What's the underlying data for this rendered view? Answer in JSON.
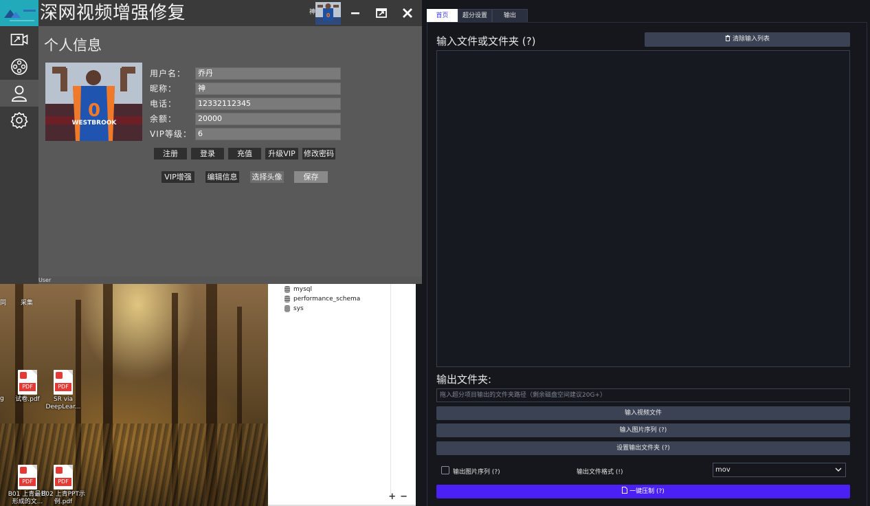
{
  "app": {
    "title": "深网视频增强修复",
    "titlebar_user": "神",
    "section_title": "个人信息",
    "status_text": "User",
    "sidebar": [
      {
        "icon": "video-export-icon"
      },
      {
        "icon": "film-reel-icon"
      },
      {
        "icon": "user-icon"
      },
      {
        "icon": "gear-icon"
      }
    ],
    "form": {
      "username_label": "用户名：",
      "username": "乔丹",
      "nickname_label": "昵称：",
      "nickname": "神",
      "phone_label": "电话：",
      "phone": "12332112345",
      "balance_label": "余额：",
      "balance": "20000",
      "vip_label": "VIP等级：",
      "vip": "6"
    },
    "buttons_row1": [
      "注册",
      "登录",
      "充值",
      "升级VIP",
      "修改密码"
    ],
    "buttons_row2": [
      "VIP增强",
      "编辑信息",
      "选择头像",
      "保存"
    ],
    "avatar_jersey": {
      "number": "0",
      "name": "WESTBROOK"
    }
  },
  "desktop": {
    "icons": [
      {
        "label": "试卷.pdf"
      },
      {
        "label": "SR via DeepLear..."
      },
      {
        "label": "B01 上青最终形成的文..."
      },
      {
        "label": "B02 上青PPT示例.pdf"
      }
    ],
    "partial_labels": [
      "采集",
      "g",
      "同"
    ],
    "pdf_tag": "PDF"
  },
  "db": {
    "items": [
      "mysql",
      "performance_schema",
      "sys"
    ],
    "controls": [
      "+",
      "−"
    ]
  },
  "right": {
    "tabs": [
      "首页",
      "超分设置",
      "输出"
    ],
    "input_label": "输入文件或文件夹 (?)",
    "clear_button": "清除输入列表",
    "output_label": "输出文件夹:",
    "output_placeholder": "拖入超分项目输出的文件夹路径（剩余磁盘空间建议20G+）",
    "btn_video": "输入视频文件",
    "btn_images": "输入图片序列 (?)",
    "btn_outdir": "设置输出文件夹 (?)",
    "chk_output_images": "输出图片序列 (?)",
    "format_label": "输出文件格式 (!)",
    "format_value": "mov",
    "compress_button": "一键压制 (?)",
    "colors": {
      "accent": "#4a20f5",
      "panel": "#3a4254",
      "bg": "#15171c"
    }
  }
}
